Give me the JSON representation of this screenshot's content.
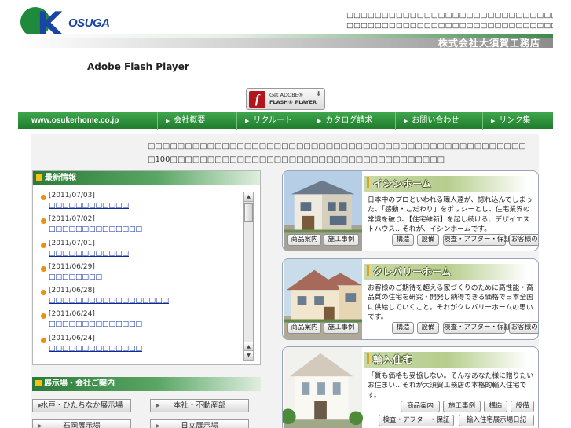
{
  "header": {
    "logo_mark": "K",
    "logo_text": "OSUGA",
    "tagline_1": "□□□□□□□□□□□□□□□□□□□□□□□□□□□□□□□□",
    "tagline_2": "□□□□□□□□□□□□□□□□□□□□□□□□□□□□□□□□□□□□□□□□",
    "company_name": "株式会社大須賀工務店"
  },
  "flash": {
    "title": "Adobe Flash Player",
    "badge_get": "Get ADOBE®",
    "badge_product": "FLASH® PLAYER",
    "badge_icon": "flash-f-icon"
  },
  "nav": {
    "url": "www.osukerhome.co.jp",
    "items": [
      "会社概要",
      "リクルート",
      "カタログ請求",
      "お問い合わせ",
      "リンク集"
    ]
  },
  "intro": {
    "line_1": "□□□□□□□□□□□□□□□□□□□□□□□□□□□□□□□□□□□□□□□□□□□□□□□□□□□",
    "line_2": "□100□□□□□□□□□□□□□□□□□□□□□□□□□□□□□□□□□□□□□"
  },
  "news": {
    "heading": "最新情報",
    "items": [
      {
        "date": "[2011/07/03]",
        "title": "□□□□□□□□□□□□"
      },
      {
        "date": "[2011/07/02]",
        "title": "□□□□□□□□□□□□□□"
      },
      {
        "date": "[2011/07/01]",
        "title": "□□□□□□□□□□□□"
      },
      {
        "date": "[2011/06/29]",
        "title": "□□□□□□□□"
      },
      {
        "date": "[2011/06/28]",
        "title": "□□□□□□□□□□□□□□□□□□"
      },
      {
        "date": "[2011/06/24]",
        "title": "□□□□□□□□□□□□□□"
      },
      {
        "date": "[2011/06/24]",
        "title": "□□□□□□□□□□□□□□"
      }
    ]
  },
  "showroom": {
    "heading": "展示場・会社ご案内",
    "buttons": [
      "水戸・ひたちなか展示場",
      "本社・不動産部",
      "石岡展示場",
      "日立展示場"
    ]
  },
  "brands": [
    {
      "title": "イシンホーム",
      "description": "日本中のプロといわれる職人達が、惚れ込んでしまった、「感動・こだわり」をポリシーとし、住宅業界の常識を破り、【住宅維新】を起し続ける、デザイエストハウス…それが、イシンホームです。",
      "buttons": [
        "商品案内",
        "施工事例",
        "構造",
        "設備",
        "検査・アフター・保証",
        "お客様の声"
      ]
    },
    {
      "title": "クレバリーホーム",
      "description": "お客様のご期待を超える家づくりのために高性能・高品質の住宅を研究・開発し納得できる価格で日本全国に供給していくこと。それがクレバリーホームの思いです。",
      "buttons": [
        "商品案内",
        "施工事例",
        "構造",
        "設備",
        "検査・アフター・保証",
        "お客様の声"
      ]
    },
    {
      "title": "輸入住宅",
      "description": "「質も価格も妥協しない。そんなあなた様に贈りたいお住まい…それが大須賀工務店の本格的輸入住宅です。",
      "buttons": [
        "商品案内",
        "施工事例",
        "構造",
        "設備",
        "検査・アフター・保証",
        "輸入住宅展示場日記"
      ]
    }
  ],
  "colors": {
    "nav_green": "#2e8f3b",
    "logo_blue": "#1a44a6",
    "accent_orange": "#e99012",
    "link_blue": "#0b2a99"
  }
}
